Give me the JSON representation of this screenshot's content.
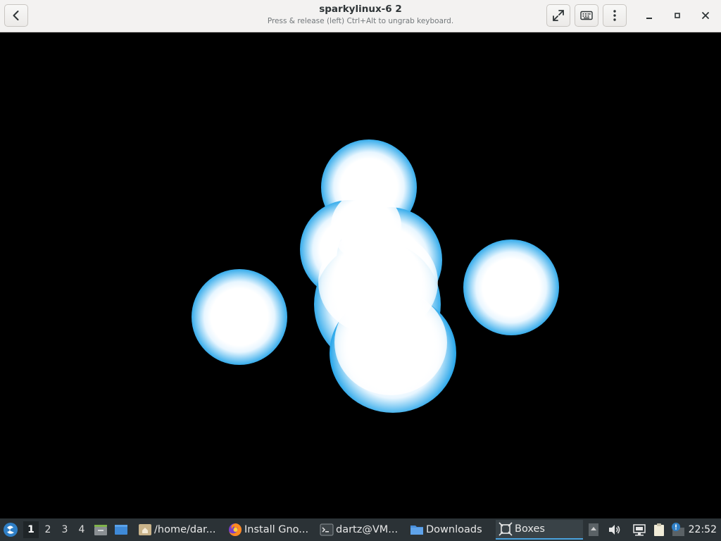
{
  "window": {
    "title": "sparkylinux-6 2",
    "subtitle": "Press & release (left) Ctrl+Alt to ungrab keyboard."
  },
  "header_buttons": {
    "back_icon": "chevron-left-icon",
    "fullscreen_icon": "expand-arrows-icon",
    "keyboard_icon": "keyboard-icon",
    "menu_icon": "vertical-ellipsis-icon",
    "minimize_icon": "minimize-icon",
    "maximize_icon": "maximize-icon",
    "close_icon": "close-icon"
  },
  "vm_display": {
    "content": "glowing blue-white orbs screensaver",
    "colors": {
      "glow": "#2aa7ea",
      "core": "#ffffff",
      "background": "#000000"
    }
  },
  "taskbar": {
    "workspaces": [
      "1",
      "2",
      "3",
      "4"
    ],
    "active_workspace": "1",
    "tasks": [
      {
        "label": "/home/dar...",
        "icon": "home-folder-icon"
      },
      {
        "label": "Install Gno...",
        "icon": "firefox-icon"
      },
      {
        "label": "dartz@VM...",
        "icon": "terminal-icon"
      },
      {
        "label": "Downloads",
        "icon": "folder-icon"
      },
      {
        "label": "Boxes",
        "icon": "boxes-icon",
        "active": true
      }
    ],
    "clock": "22:52",
    "accent": "#4aa3df",
    "background": "#2b3236"
  }
}
